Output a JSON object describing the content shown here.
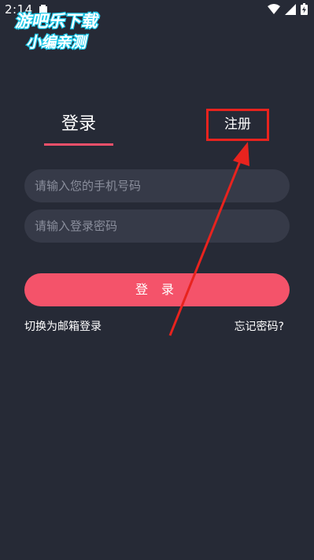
{
  "status_bar": {
    "time": "2:14",
    "icons": [
      "app-notification-icon",
      "wifi-icon",
      "signal-icon",
      "battery-icon"
    ]
  },
  "watermark": {
    "line1": "游吧乐下载",
    "line2": "小编亲测"
  },
  "tabs": {
    "login": "登录",
    "register": "注册"
  },
  "form": {
    "phone_placeholder": "请输入您的手机号码",
    "password_placeholder": "请输入登录密码",
    "login_button": "登 录",
    "switch_email": "切换为邮箱登录",
    "forgot_password": "忘记密码?"
  },
  "colors": {
    "background": "#262a36",
    "accent": "#f4536a",
    "input_bg": "#363a48",
    "annotation": "#e8231e"
  }
}
